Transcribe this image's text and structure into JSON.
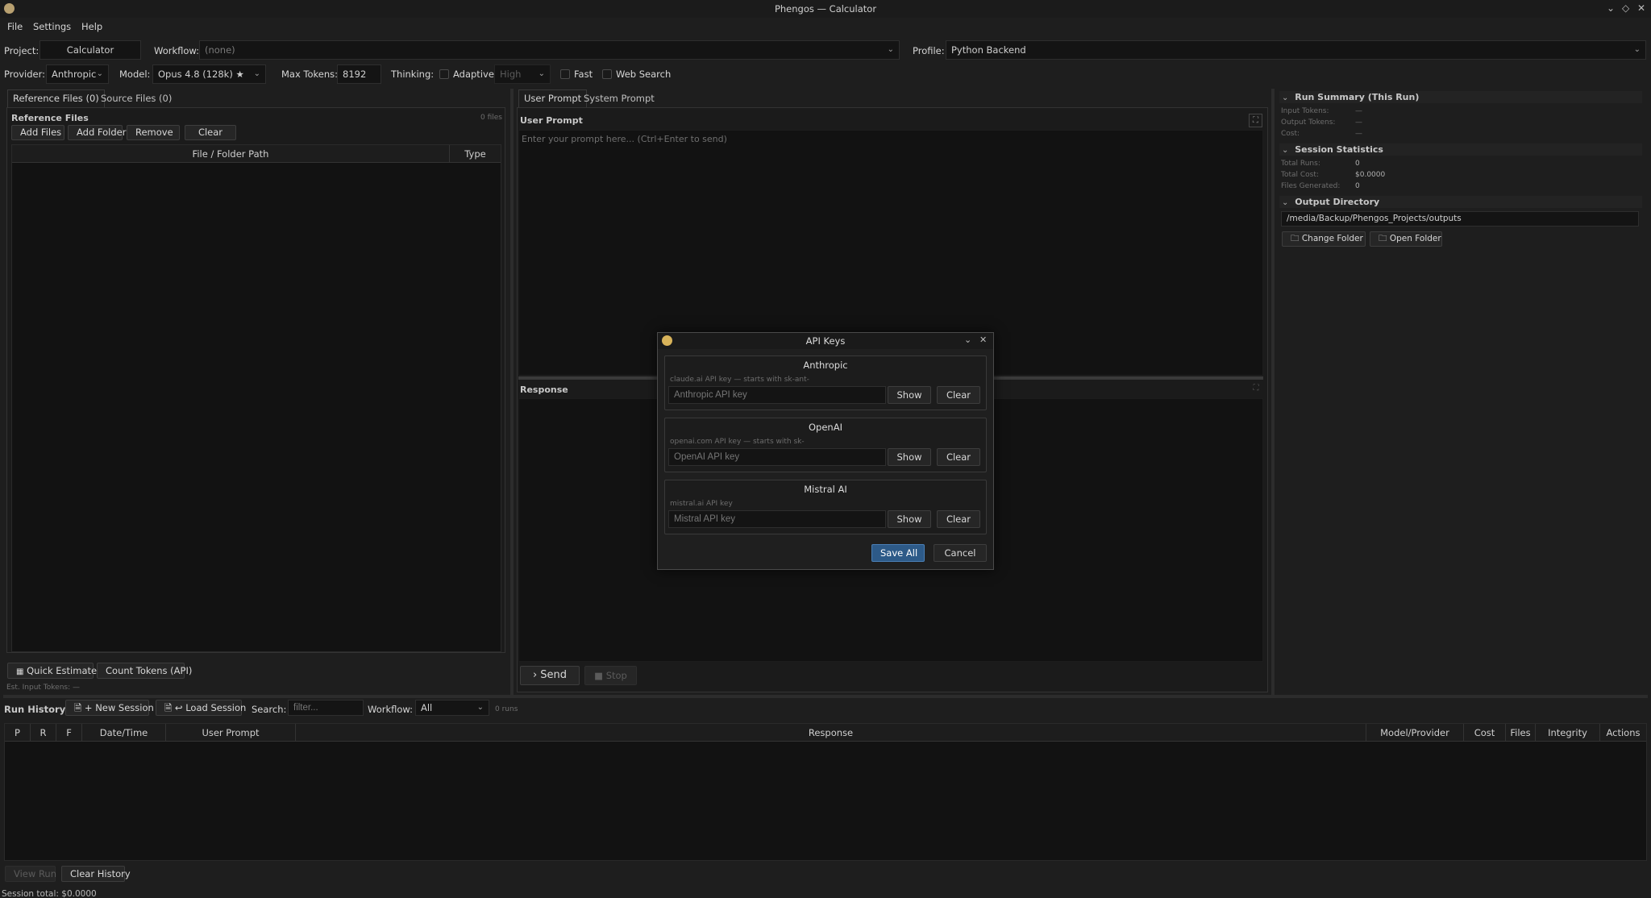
{
  "window": {
    "title": "Phengos — Calculator"
  },
  "menu": [
    "File",
    "Settings",
    "Help"
  ],
  "toolbar": {
    "project_label": "Project:",
    "project_value": "Calculator",
    "workflow_label": "Workflow:",
    "workflow_value": "(none)",
    "profile_label": "Profile:",
    "profile_value": "Python Backend",
    "provider_label": "Provider:",
    "provider_value": "Anthropic",
    "model_label": "Model:",
    "model_value": "Opus 4.8 (128k) ★",
    "max_tokens_label": "Max Tokens:",
    "max_tokens_value": "8192",
    "thinking_label": "Thinking:",
    "adaptive_label": "Adaptive",
    "effort_value": "High",
    "fast_label": "Fast",
    "web_search_label": "Web Search"
  },
  "left": {
    "tabs": [
      "Reference Files (0)",
      "Source Files (0)"
    ],
    "section_title": "Reference Files",
    "count": "0 files",
    "buttons": [
      "Add Files",
      "Add Folder",
      "Remove",
      "Clear"
    ],
    "columns": [
      "File / Folder Path",
      "Type"
    ],
    "quick_estimate": "Quick Estimate",
    "count_tokens": "Count Tokens (API)",
    "est_input": "Est. Input Tokens: —"
  },
  "center": {
    "tabs": [
      "User Prompt",
      "System Prompt"
    ],
    "prompt_title": "User Prompt",
    "prompt_placeholder": "Enter your prompt here... (Ctrl+Enter to send)",
    "response_title": "Response",
    "send_label": "Send",
    "stop_label": "Stop"
  },
  "right": {
    "run_summary_title": "Run Summary (This Run)",
    "run_summary": [
      {
        "label": "Input Tokens:",
        "value": "—"
      },
      {
        "label": "Output Tokens:",
        "value": "—"
      },
      {
        "label": "Cost:",
        "value": "—"
      }
    ],
    "session_title": "Session Statistics",
    "session": [
      {
        "label": "Total Runs:",
        "value": "0"
      },
      {
        "label": "Total Cost:",
        "value": "$0.0000"
      },
      {
        "label": "Files Generated:",
        "value": "0"
      }
    ],
    "output_title": "Output Directory",
    "output_path": "/media/Backup/Phengos_Projects/outputs",
    "change_folder": "Change Folder",
    "open_folder": "Open Folder"
  },
  "history": {
    "title": "Run History",
    "new_session": "+ New Session",
    "load_session": "↩ Load Session",
    "search_label": "Search:",
    "search_placeholder": "filter...",
    "workflow_label": "Workflow:",
    "workflow_value": "All",
    "runs_count": "0 runs",
    "columns": [
      "P",
      "R",
      "F",
      "Date/Time",
      "User Prompt",
      "Response",
      "Model/Provider",
      "Cost",
      "Files",
      "Integrity",
      "Actions"
    ],
    "view_run": "View Run",
    "clear_history": "Clear History"
  },
  "status_bar": {
    "text": "Session total: $0.0000"
  },
  "dialog": {
    "title": "API Keys",
    "groups": [
      {
        "title": "Anthropic",
        "hint": "claude.ai API key — starts with sk-ant-",
        "field": "Anthropic API key"
      },
      {
        "title": "OpenAI",
        "hint": "openai.com API key — starts with sk-",
        "field": "OpenAI API key"
      },
      {
        "title": "Mistral AI",
        "hint": "mistral.ai API key",
        "field": "Mistral API key"
      }
    ],
    "show_label": "Show",
    "clear_label": "Clear",
    "save_all": "Save All",
    "cancel": "Cancel"
  },
  "colors": {
    "accent": "#2d5a88",
    "background": "#1e1e1e",
    "panel": "#121212"
  }
}
